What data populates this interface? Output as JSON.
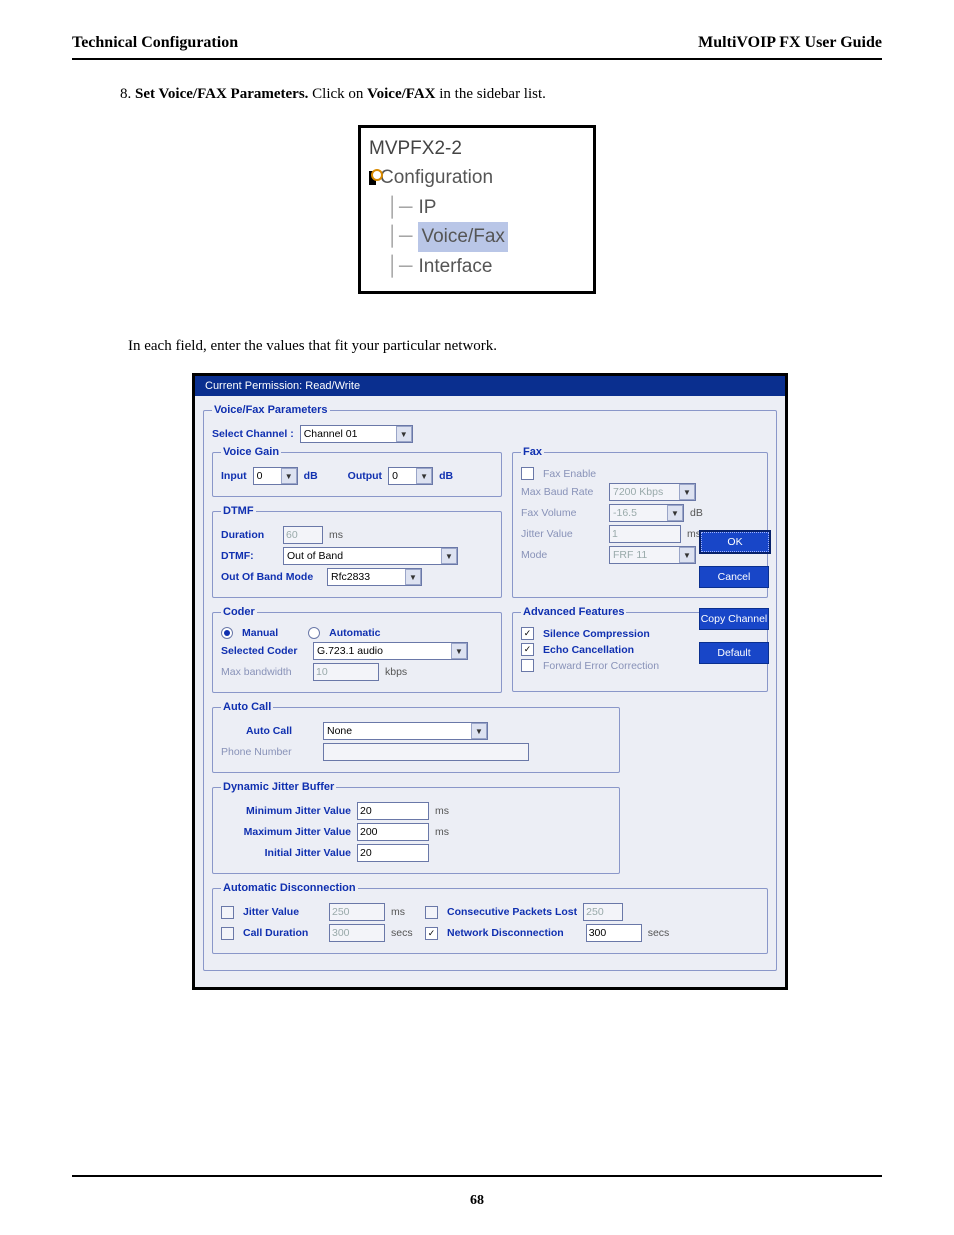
{
  "header": {
    "left": "Technical Configuration",
    "right": "MultiVOIP FX User Guide"
  },
  "step": {
    "number": "8.",
    "bold1": "Set Voice/FAX Parameters.",
    "mid": "  Click on ",
    "bold2": "Voice/FAX",
    "tail": " in the sidebar list."
  },
  "tree": {
    "root": "MVPFX2-2",
    "node": "Configuration",
    "items": [
      "IP",
      "Voice/Fax",
      "Interface"
    ],
    "selected_index": 1
  },
  "intro": "In each field, enter the values that fit  your particular network.",
  "app": {
    "status": "Current Permission:  Read/Write",
    "main_legend": "Voice/Fax Parameters",
    "select_channel_label": "Select Channel :",
    "select_channel_value": "Channel 01",
    "voice_gain": {
      "legend": "Voice Gain",
      "input_label": "Input",
      "input_value": "0",
      "input_unit": "dB",
      "output_label": "Output",
      "output_value": "0",
      "output_unit": "dB"
    },
    "dtmf": {
      "legend": "DTMF",
      "duration_label": "Duration",
      "duration_value": "60",
      "duration_unit": "ms",
      "dtmf_label": "DTMF:",
      "dtmf_value": "Out of Band",
      "oob_label": "Out Of Band Mode",
      "oob_value": "Rfc2833"
    },
    "fax": {
      "legend": "Fax",
      "enable_label": "Fax Enable",
      "enable_checked": false,
      "baud_label": "Max Baud Rate",
      "baud_value": "7200 Kbps",
      "vol_label": "Fax Volume",
      "vol_value": "-16.5",
      "vol_unit": "dB",
      "jitter_label": "Jitter Value",
      "jitter_value": "1",
      "jitter_unit": "ms",
      "mode_label": "Mode",
      "mode_value": "FRF 11"
    },
    "coder": {
      "legend": "Coder",
      "manual_label": "Manual",
      "auto_label": "Automatic",
      "mode": "manual",
      "selected_label": "Selected Coder",
      "selected_value": "G.723.1 audio",
      "bw_label": "Max bandwidth",
      "bw_value": "10",
      "bw_unit": "kbps"
    },
    "adv": {
      "legend": "Advanced Features",
      "sc_label": "Silence Compression",
      "sc_checked": true,
      "ec_label": "Echo Cancellation",
      "ec_checked": true,
      "fec_label": "Forward Error Correction",
      "fec_checked": false
    },
    "auto_call": {
      "legend": "Auto Call",
      "ac_label": "Auto Call",
      "ac_value": "None",
      "phone_label": "Phone Number",
      "phone_value": ""
    },
    "jitter": {
      "legend": "Dynamic Jitter Buffer",
      "min_label": "Minimum Jitter Value",
      "min_value": "20",
      "min_unit": "ms",
      "max_label": "Maximum Jitter Value",
      "max_value": "200",
      "max_unit": "ms",
      "init_label": "Initial Jitter Value",
      "init_value": "20"
    },
    "disc": {
      "legend": "Automatic Disconnection",
      "jv_label": "Jitter Value",
      "jv_checked": false,
      "jv_value": "250",
      "jv_unit": "ms",
      "cp_label": "Consecutive Packets Lost",
      "cp_checked": false,
      "cp_value": "250",
      "cd_label": "Call Duration",
      "cd_checked": false,
      "cd_value": "300",
      "cd_unit": "secs",
      "nd_label": "Network Disconnection",
      "nd_checked": true,
      "nd_value": "300",
      "nd_unit": "secs"
    },
    "buttons": {
      "ok": "OK",
      "cancel": "Cancel",
      "copy": "Copy Channel",
      "def": "Default"
    }
  },
  "page_number": "68"
}
